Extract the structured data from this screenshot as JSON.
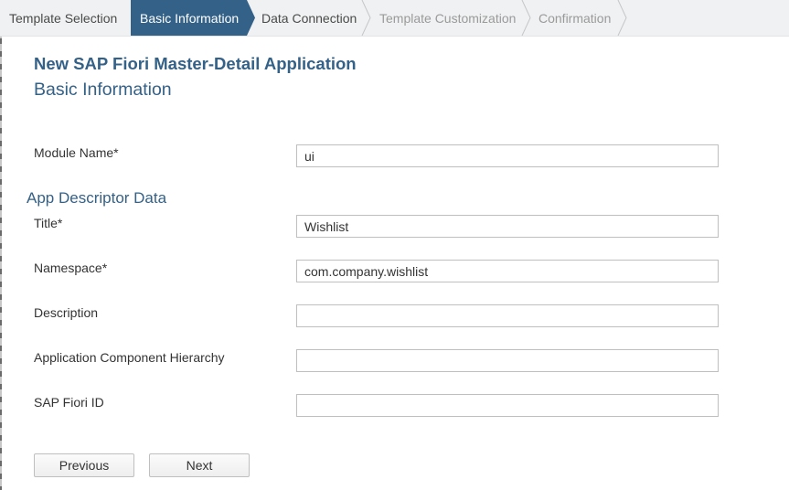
{
  "wizard": {
    "steps": [
      {
        "label": "Template Selection",
        "state": "completed"
      },
      {
        "label": "Basic Information",
        "state": "active"
      },
      {
        "label": "Data Connection",
        "state": "upcoming"
      },
      {
        "label": "Template Customization",
        "state": "disabled"
      },
      {
        "label": "Confirmation",
        "state": "disabled"
      }
    ]
  },
  "header": {
    "title": "New SAP Fiori Master-Detail Application",
    "subtitle": "Basic Information"
  },
  "form": {
    "module_name": {
      "label": "Module Name*",
      "value": "ui"
    },
    "section_title": "App Descriptor Data",
    "title": {
      "label": "Title*",
      "value": "Wishlist"
    },
    "namespace": {
      "label": "Namespace*",
      "value": "com.company.wishlist"
    },
    "description": {
      "label": "Description",
      "value": ""
    },
    "component_hierarchy": {
      "label": "Application Component Hierarchy",
      "value": ""
    },
    "fiori_id": {
      "label": "SAP Fiori ID",
      "value": ""
    }
  },
  "buttons": {
    "previous": "Previous",
    "next": "Next"
  },
  "colors": {
    "accent": "#346187",
    "wizard_bg": "#f0f1f2",
    "disabled_text": "#9a9a9a"
  }
}
